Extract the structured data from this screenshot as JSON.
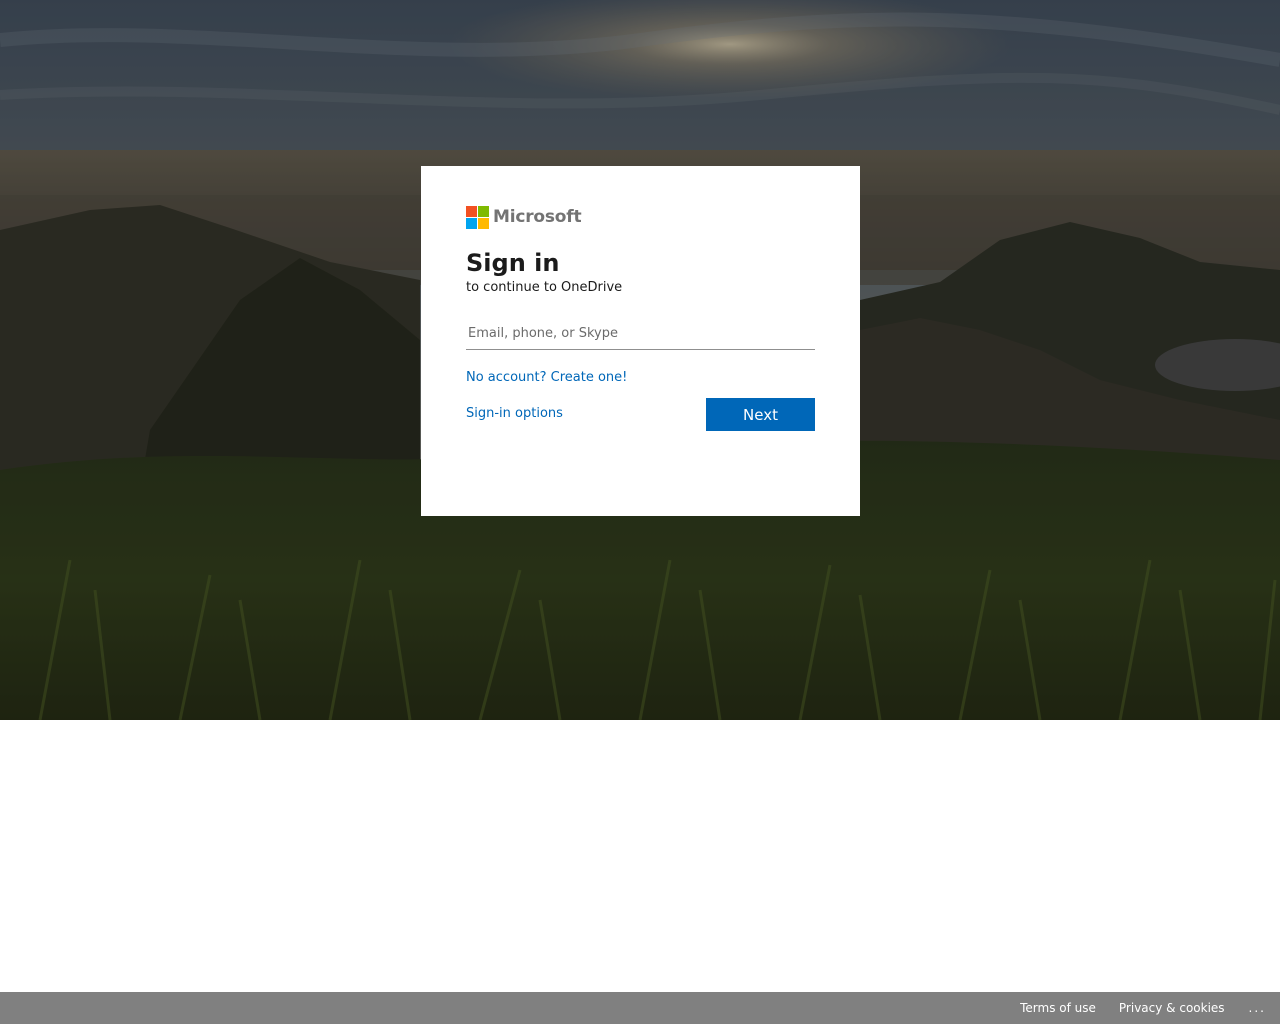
{
  "brand": {
    "name": "Microsoft",
    "logo_colors": [
      "#f25022",
      "#7fba00",
      "#00a4ef",
      "#ffb900"
    ]
  },
  "signin": {
    "title": "Sign in",
    "subtitle": "to continue to OneDrive",
    "email_placeholder": "Email, phone, or Skype",
    "email_value": "",
    "create_account_link": "No account? Create one!",
    "signin_options_link": "Sign-in options",
    "next_button": "Next"
  },
  "footer": {
    "terms": "Terms of use",
    "privacy": "Privacy & cookies",
    "more": "..."
  },
  "colors": {
    "accent": "#0067b8",
    "footer_bg": "#808080"
  }
}
